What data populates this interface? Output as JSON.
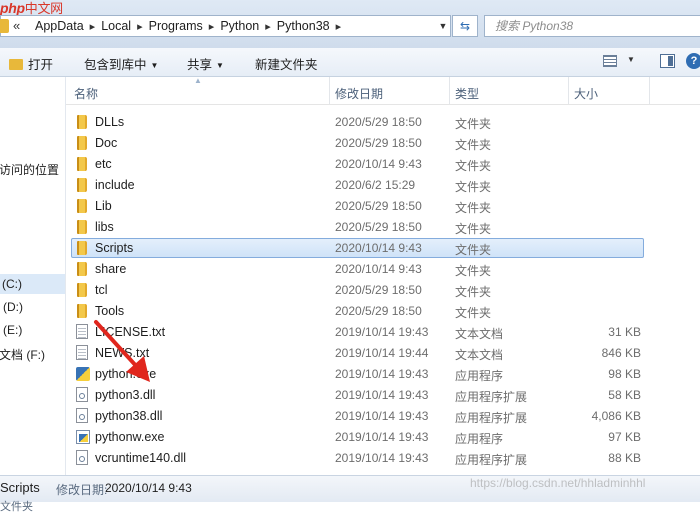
{
  "logo": {
    "text": "php",
    "cn": "中文网"
  },
  "address": {
    "overflow": "«",
    "crumbs": [
      "AppData",
      "Local",
      "Programs",
      "Python",
      "Python38"
    ],
    "search_placeholder": "搜索 Python38"
  },
  "toolbar": {
    "open": "打开",
    "include_in_library": "包含到库中",
    "share": "共享",
    "new_folder": "新建文件夹"
  },
  "nav": {
    "recent_places": "访问的位置",
    "drive_c": "(C:)",
    "drive_d": "(D:)",
    "drive_e": "(E:)",
    "drive_f": "文档 (F:)"
  },
  "columns": {
    "name": "名称",
    "date": "修改日期",
    "type": "类型",
    "size": "大小"
  },
  "files": [
    {
      "name": "DLLs",
      "date": "2020/5/29 18:50",
      "type": "文件夹",
      "size": "",
      "icon": "folder-icon"
    },
    {
      "name": "Doc",
      "date": "2020/5/29 18:50",
      "type": "文件夹",
      "size": "",
      "icon": "folder-icon"
    },
    {
      "name": "etc",
      "date": "2020/10/14 9:43",
      "type": "文件夹",
      "size": "",
      "icon": "folder-icon"
    },
    {
      "name": "include",
      "date": "2020/6/2 15:29",
      "type": "文件夹",
      "size": "",
      "icon": "folder-icon"
    },
    {
      "name": "Lib",
      "date": "2020/5/29 18:50",
      "type": "文件夹",
      "size": "",
      "icon": "folder-icon"
    },
    {
      "name": "libs",
      "date": "2020/5/29 18:50",
      "type": "文件夹",
      "size": "",
      "icon": "folder-icon"
    },
    {
      "name": "Scripts",
      "date": "2020/10/14 9:43",
      "type": "文件夹",
      "size": "",
      "icon": "folder-icon",
      "selected": true
    },
    {
      "name": "share",
      "date": "2020/10/14 9:43",
      "type": "文件夹",
      "size": "",
      "icon": "folder-icon"
    },
    {
      "name": "tcl",
      "date": "2020/5/29 18:50",
      "type": "文件夹",
      "size": "",
      "icon": "folder-icon"
    },
    {
      "name": "Tools",
      "date": "2020/5/29 18:50",
      "type": "文件夹",
      "size": "",
      "icon": "folder-icon"
    },
    {
      "name": "LICENSE.txt",
      "date": "2019/10/14 19:43",
      "type": "文本文档",
      "size": "31 KB",
      "icon": "text-file-icon"
    },
    {
      "name": "NEWS.txt",
      "date": "2019/10/14 19:44",
      "type": "文本文档",
      "size": "846 KB",
      "icon": "text-file-icon"
    },
    {
      "name": "python.exe",
      "date": "2019/10/14 19:43",
      "type": "应用程序",
      "size": "98 KB",
      "icon": "python-exe-icon"
    },
    {
      "name": "python3.dll",
      "date": "2019/10/14 19:43",
      "type": "应用程序扩展",
      "size": "58 KB",
      "icon": "dll-file-icon"
    },
    {
      "name": "python38.dll",
      "date": "2019/10/14 19:43",
      "type": "应用程序扩展",
      "size": "4,086 KB",
      "icon": "dll-file-icon"
    },
    {
      "name": "pythonw.exe",
      "date": "2019/10/14 19:43",
      "type": "应用程序",
      "size": "97 KB",
      "icon": "pythonw-exe-icon"
    },
    {
      "name": "vcruntime140.dll",
      "date": "2019/10/14 19:43",
      "type": "应用程序扩展",
      "size": "88 KB",
      "icon": "dll-file-icon"
    }
  ],
  "status": {
    "name": "Scripts",
    "date_label": "修改日期:",
    "date_value": "2020/10/14 9:43",
    "sub": "文件夹"
  },
  "watermark": "https://blog.csdn.net/hhladminhhl",
  "colors": {
    "selection_bg": "#cfe3f8",
    "selection_border": "#84acdd",
    "arrow": "#e0261d"
  }
}
